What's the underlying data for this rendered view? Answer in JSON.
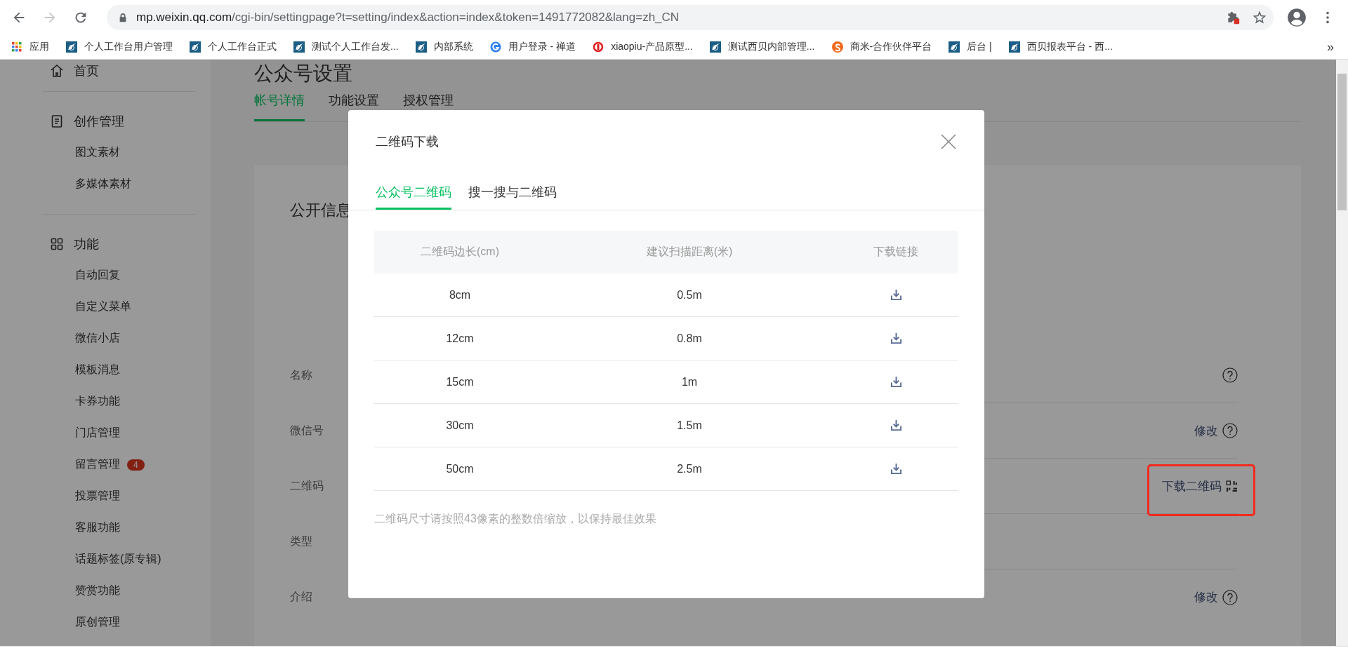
{
  "browser": {
    "url_host": "mp.weixin.qq.com",
    "url_path": "/cgi-bin/settingpage?t=setting/index&action=index&token=1491772082&lang=zh_CN",
    "bookmarks": [
      {
        "label": "应用",
        "kind": "apps"
      },
      {
        "label": "个人工作台用户管理",
        "kind": "logo"
      },
      {
        "label": "个人工作台正式",
        "kind": "logo"
      },
      {
        "label": "测试个人工作台发...",
        "kind": "logo"
      },
      {
        "label": "内部系统",
        "kind": "logo"
      },
      {
        "label": "用户登录 - 禅道",
        "kind": "swirl"
      },
      {
        "label": "xiaopiu-产品原型...",
        "kind": "ring"
      },
      {
        "label": "测试西贝内部管理...",
        "kind": "logo"
      },
      {
        "label": "商米-合作伙伴平台",
        "kind": "orange"
      },
      {
        "label": "后台 |",
        "kind": "logo"
      },
      {
        "label": "西贝报表平台 - 西...",
        "kind": "logo"
      }
    ],
    "more": "»"
  },
  "sidebar": [
    {
      "title": "首页",
      "kind": "home"
    },
    {
      "title": "创作管理",
      "kind": "doc",
      "items": [
        {
          "label": "图文素材"
        },
        {
          "label": "多媒体素材"
        }
      ]
    },
    {
      "title": "功能",
      "kind": "grid",
      "items": [
        {
          "label": "自动回复"
        },
        {
          "label": "自定义菜单"
        },
        {
          "label": "微信小店"
        },
        {
          "label": "模板消息"
        },
        {
          "label": "卡券功能"
        },
        {
          "label": "门店管理"
        },
        {
          "label": "留言管理",
          "badge": "4"
        },
        {
          "label": "投票管理"
        },
        {
          "label": "客服功能"
        },
        {
          "label": "话题标签(原专辑)"
        },
        {
          "label": "赞赏功能"
        },
        {
          "label": "原创管理"
        }
      ]
    }
  ],
  "page": {
    "title": "公众号设置",
    "tabs": [
      {
        "label": "帐号详情",
        "selected": true
      },
      {
        "label": "功能设置",
        "selected": false
      },
      {
        "label": "授权管理",
        "selected": false
      }
    ],
    "section_title": "公开信息",
    "fields": [
      {
        "label": "名称",
        "kind": "help"
      },
      {
        "label": "微信号",
        "action": "修改",
        "kind": "help"
      },
      {
        "label": "二维码",
        "action": "下载二维码",
        "kind": "qr",
        "highlighted": true
      },
      {
        "label": "类型"
      },
      {
        "label": "介绍",
        "action": "修改",
        "kind": "help"
      }
    ]
  },
  "modal": {
    "title": "二维码下载",
    "tabs": [
      {
        "label": "公众号二维码",
        "selected": true
      },
      {
        "label": "搜一搜与二维码",
        "selected": false
      }
    ],
    "columns": [
      "二维码边长(cm)",
      "建议扫描距离(米)",
      "下载链接"
    ],
    "rows": [
      {
        "size": "8cm",
        "distance": "0.5m"
      },
      {
        "size": "12cm",
        "distance": "0.8m"
      },
      {
        "size": "15cm",
        "distance": "1m"
      },
      {
        "size": "30cm",
        "distance": "1.5m"
      },
      {
        "size": "50cm",
        "distance": "2.5m"
      }
    ],
    "note": "二维码尺寸请按照43像素的整数倍缩放，以保持最佳效果"
  }
}
